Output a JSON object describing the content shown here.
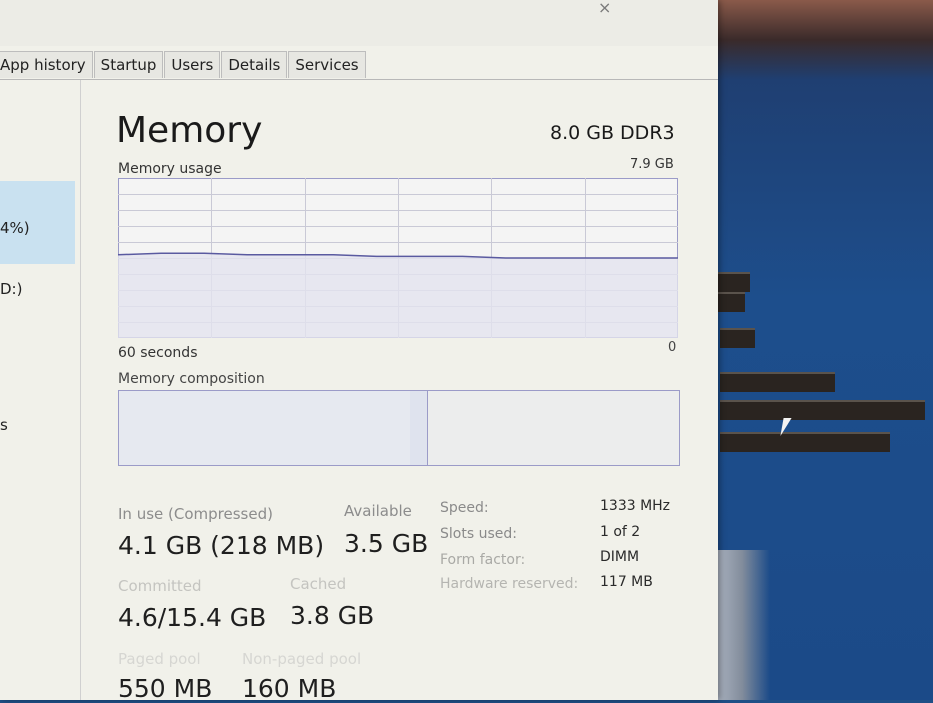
{
  "window": {
    "close_glyph": "×"
  },
  "tabs": [
    "App history",
    "Startup",
    "Users",
    "Details",
    "Services"
  ],
  "sidebar": {
    "items": [
      {
        "text": "4%)"
      },
      {
        "text": "D:)"
      },
      {
        "text": "s"
      }
    ]
  },
  "memory": {
    "title": "Memory",
    "spec": "8.0 GB DDR3",
    "usage_label": "Memory usage",
    "usage_max": "7.9 GB",
    "time_label": "60 seconds",
    "time_zero": "0",
    "composition_label": "Memory composition",
    "usage_trace": [
      0.52,
      0.53,
      0.53,
      0.52,
      0.52,
      0.52,
      0.51,
      0.51,
      0.51,
      0.5,
      0.5,
      0.5,
      0.5,
      0.5
    ],
    "composition": {
      "in_use_fraction": 0.52,
      "modified_fraction": 0.03
    }
  },
  "stats": {
    "in_use_label": "In use (Compressed)",
    "in_use_value": "4.1 GB (218 MB)",
    "available_label": "Available",
    "available_value": "3.5 GB",
    "committed_label": "Committed",
    "committed_value": "4.6/15.4 GB",
    "cached_label": "Cached",
    "cached_value": "3.8 GB",
    "paged_label": "Paged pool",
    "paged_value": "550 MB",
    "nonpaged_label": "Non-paged pool",
    "nonpaged_value": "160 MB"
  },
  "specs": [
    {
      "label": "Speed:",
      "value": "1333 MHz"
    },
    {
      "label": "Slots used:",
      "value": "1 of 2"
    },
    {
      "label": "Form factor:",
      "value": "DIMM"
    },
    {
      "label": "Hardware reserved:",
      "value": "117 MB"
    }
  ],
  "colors": {
    "graph_border": "#9b9bc8",
    "graph_fill": "#e3e3ef",
    "graph_line": "#5a5aa0",
    "grid": "#c9c9d6",
    "selected": "#c9e1f0"
  }
}
